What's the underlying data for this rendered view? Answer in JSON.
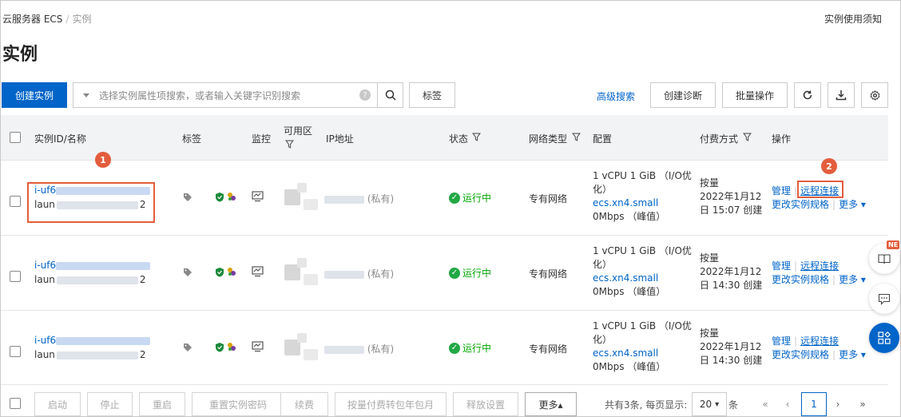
{
  "breadcrumb": {
    "root": "云服务器 ECS",
    "separator": "/",
    "current": "实例"
  },
  "header": {
    "notice": "实例使用须知",
    "title": "实例"
  },
  "toolbar": {
    "create_label": "创建实例",
    "search_placeholder": "选择实例属性项搜索，或者输入关键字识别搜索",
    "help_glyph": "?",
    "tag_label": "标签",
    "advanced_search": "高级搜索",
    "diagnose_label": "创建诊断",
    "batch_label": "批量操作"
  },
  "table": {
    "columns": {
      "id": "实例ID/名称",
      "tag": "标签",
      "monitor": "监控",
      "zone": "可用区",
      "ip": "IP地址",
      "status": "状态",
      "network": "网络类型",
      "config": "配置",
      "billing": "付费方式",
      "action": "操作"
    },
    "rows": [
      {
        "id_prefix": "i-uf6",
        "name_prefix": "laun",
        "name_suffix": "2",
        "ip_note": "(私有)",
        "status": "运行中",
        "network": "专有网络",
        "config_line1": "1 vCPU 1 GiB （I/O优",
        "config_line2": "化）",
        "config_type": "ecs.xn4.small",
        "config_bw": "0Mbps （峰值）",
        "billing_type": "按量",
        "billing_line2": "2022年1月12",
        "billing_line3": "日 15:07 创建",
        "act_manage": "管理",
        "act_remote": "远程连接",
        "act_resize": "更改实例规格",
        "act_more": "更多"
      },
      {
        "id_prefix": "i-uf6",
        "name_prefix": "laun",
        "name_suffix": "2",
        "ip_note": "(私有)",
        "status": "运行中",
        "network": "专有网络",
        "config_line1": "1 vCPU 1 GiB （I/O优",
        "config_line2": "化）",
        "config_type": "ecs.xn4.small",
        "config_bw": "0Mbps （峰值）",
        "billing_type": "按量",
        "billing_line2": "2022年1月12",
        "billing_line3": "日 14:30 创建",
        "act_manage": "管理",
        "act_remote": "远程连接",
        "act_resize": "更改实例规格",
        "act_more": "更多"
      },
      {
        "id_prefix": "i-uf6",
        "name_prefix": "laun",
        "name_suffix": "2",
        "ip_note": "(私有)",
        "status": "运行中",
        "network": "专有网络",
        "config_line1": "1 vCPU 1 GiB （I/O优",
        "config_line2": "化）",
        "config_type": "ecs.xn4.small",
        "config_bw": "0Mbps （峰值）",
        "billing_type": "按量",
        "billing_line2": "2022年1月12",
        "billing_line3": "日 14:30 创建",
        "act_manage": "管理",
        "act_remote": "远程连接",
        "act_resize": "更改实例规格",
        "act_more": "更多"
      }
    ]
  },
  "callouts": [
    "1",
    "2"
  ],
  "footer": {
    "start": "启动",
    "stop": "停止",
    "restart": "重启",
    "reset_password": "重置实例密码",
    "renew": "续费",
    "convert_billing": "按量付费转包年包月",
    "release": "释放设置",
    "more": "更多▴",
    "summary": "共有3条, 每页显示:",
    "page_size": "20",
    "unit": "条",
    "current_page": "1"
  },
  "side_float": {
    "new_badge": "NE"
  },
  "colors": {
    "primary": "#0064c8",
    "running": "#00a700",
    "callout": "#e35d3d",
    "header_bg": "#f2f3f5"
  },
  "icons": [
    "search-icon",
    "refresh-icon",
    "download-icon",
    "settings-icon",
    "filter-icon",
    "tag-icon",
    "shield-icon",
    "monitor-icon",
    "check-circle-icon",
    "book-icon",
    "chat-icon",
    "apps-icon"
  ]
}
